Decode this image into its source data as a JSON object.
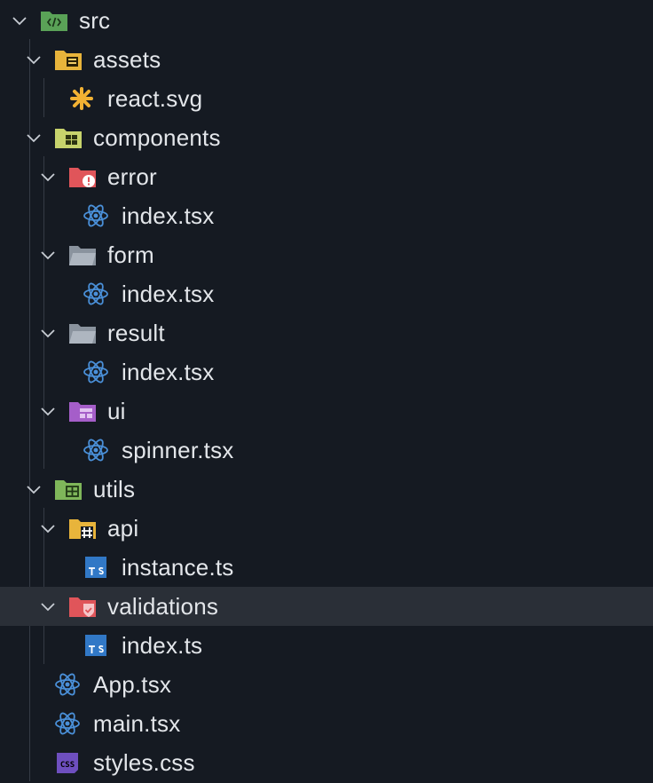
{
  "explorer": {
    "items": [
      {
        "label": "src",
        "kind": "folder",
        "expanded": true,
        "icon": "folder-src-icon"
      },
      {
        "label": "assets",
        "kind": "folder",
        "expanded": true,
        "icon": "folder-assets-icon"
      },
      {
        "label": "react.svg",
        "kind": "file",
        "icon": "svg-file-icon"
      },
      {
        "label": "components",
        "kind": "folder",
        "expanded": true,
        "icon": "folder-components-icon"
      },
      {
        "label": "error",
        "kind": "folder",
        "expanded": true,
        "icon": "folder-error-icon"
      },
      {
        "label": "index.tsx",
        "kind": "file",
        "icon": "react-icon"
      },
      {
        "label": "form",
        "kind": "folder",
        "expanded": true,
        "icon": "folder-icon"
      },
      {
        "label": "index.tsx",
        "kind": "file",
        "icon": "react-icon"
      },
      {
        "label": "result",
        "kind": "folder",
        "expanded": true,
        "icon": "folder-icon"
      },
      {
        "label": "index.tsx",
        "kind": "file",
        "icon": "react-icon"
      },
      {
        "label": "ui",
        "kind": "folder",
        "expanded": true,
        "icon": "folder-ui-icon"
      },
      {
        "label": "spinner.tsx",
        "kind": "file",
        "icon": "react-icon"
      },
      {
        "label": "utils",
        "kind": "folder",
        "expanded": true,
        "icon": "folder-utils-icon"
      },
      {
        "label": "api",
        "kind": "folder",
        "expanded": true,
        "icon": "folder-api-icon"
      },
      {
        "label": "instance.ts",
        "kind": "file",
        "icon": "typescript-icon"
      },
      {
        "label": "validations",
        "kind": "folder",
        "expanded": true,
        "icon": "folder-validations-icon",
        "selected": true
      },
      {
        "label": "index.ts",
        "kind": "file",
        "icon": "typescript-icon"
      },
      {
        "label": "App.tsx",
        "kind": "file",
        "icon": "react-icon"
      },
      {
        "label": "main.tsx",
        "kind": "file",
        "icon": "react-icon"
      },
      {
        "label": "styles.css",
        "kind": "file",
        "icon": "css-icon"
      }
    ]
  },
  "colors": {
    "background": "#151a22",
    "selected_row": "#2a2f37",
    "react": "#4a90d9",
    "typescript": "#3178c6",
    "css": "#6e4fbf"
  }
}
